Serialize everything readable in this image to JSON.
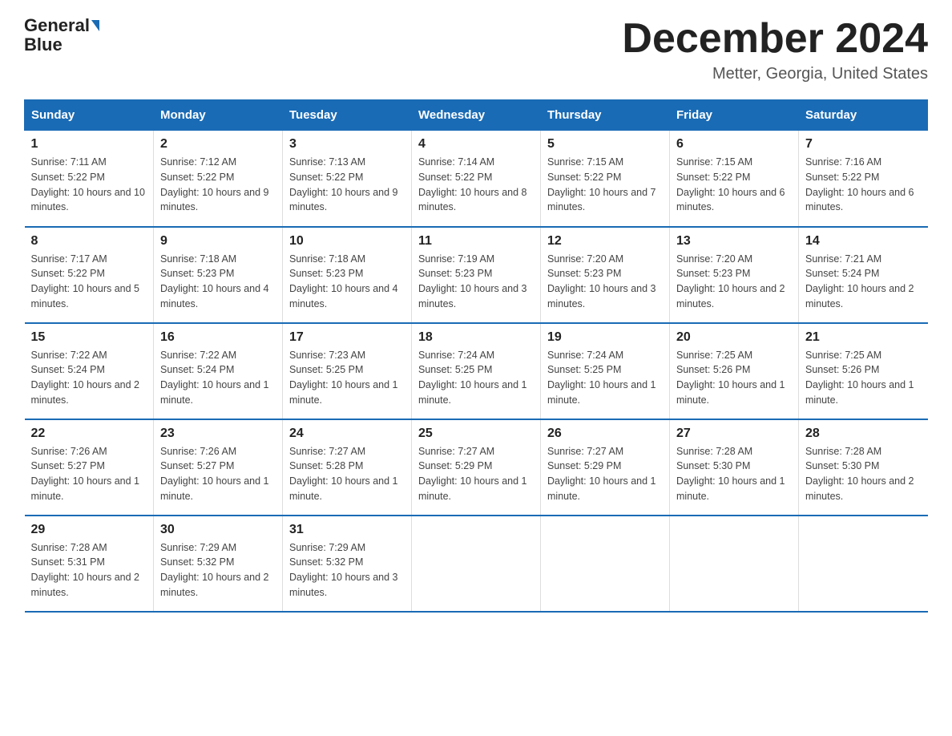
{
  "logo": {
    "text_general": "General",
    "text_blue": "Blue"
  },
  "title": "December 2024",
  "location": "Metter, Georgia, United States",
  "days_of_week": [
    "Sunday",
    "Monday",
    "Tuesday",
    "Wednesday",
    "Thursday",
    "Friday",
    "Saturday"
  ],
  "weeks": [
    [
      {
        "day": "1",
        "sunrise": "7:11 AM",
        "sunset": "5:22 PM",
        "daylight": "10 hours and 10 minutes."
      },
      {
        "day": "2",
        "sunrise": "7:12 AM",
        "sunset": "5:22 PM",
        "daylight": "10 hours and 9 minutes."
      },
      {
        "day": "3",
        "sunrise": "7:13 AM",
        "sunset": "5:22 PM",
        "daylight": "10 hours and 9 minutes."
      },
      {
        "day": "4",
        "sunrise": "7:14 AM",
        "sunset": "5:22 PM",
        "daylight": "10 hours and 8 minutes."
      },
      {
        "day": "5",
        "sunrise": "7:15 AM",
        "sunset": "5:22 PM",
        "daylight": "10 hours and 7 minutes."
      },
      {
        "day": "6",
        "sunrise": "7:15 AM",
        "sunset": "5:22 PM",
        "daylight": "10 hours and 6 minutes."
      },
      {
        "day": "7",
        "sunrise": "7:16 AM",
        "sunset": "5:22 PM",
        "daylight": "10 hours and 6 minutes."
      }
    ],
    [
      {
        "day": "8",
        "sunrise": "7:17 AM",
        "sunset": "5:22 PM",
        "daylight": "10 hours and 5 minutes."
      },
      {
        "day": "9",
        "sunrise": "7:18 AM",
        "sunset": "5:23 PM",
        "daylight": "10 hours and 4 minutes."
      },
      {
        "day": "10",
        "sunrise": "7:18 AM",
        "sunset": "5:23 PM",
        "daylight": "10 hours and 4 minutes."
      },
      {
        "day": "11",
        "sunrise": "7:19 AM",
        "sunset": "5:23 PM",
        "daylight": "10 hours and 3 minutes."
      },
      {
        "day": "12",
        "sunrise": "7:20 AM",
        "sunset": "5:23 PM",
        "daylight": "10 hours and 3 minutes."
      },
      {
        "day": "13",
        "sunrise": "7:20 AM",
        "sunset": "5:23 PM",
        "daylight": "10 hours and 2 minutes."
      },
      {
        "day": "14",
        "sunrise": "7:21 AM",
        "sunset": "5:24 PM",
        "daylight": "10 hours and 2 minutes."
      }
    ],
    [
      {
        "day": "15",
        "sunrise": "7:22 AM",
        "sunset": "5:24 PM",
        "daylight": "10 hours and 2 minutes."
      },
      {
        "day": "16",
        "sunrise": "7:22 AM",
        "sunset": "5:24 PM",
        "daylight": "10 hours and 1 minute."
      },
      {
        "day": "17",
        "sunrise": "7:23 AM",
        "sunset": "5:25 PM",
        "daylight": "10 hours and 1 minute."
      },
      {
        "day": "18",
        "sunrise": "7:24 AM",
        "sunset": "5:25 PM",
        "daylight": "10 hours and 1 minute."
      },
      {
        "day": "19",
        "sunrise": "7:24 AM",
        "sunset": "5:25 PM",
        "daylight": "10 hours and 1 minute."
      },
      {
        "day": "20",
        "sunrise": "7:25 AM",
        "sunset": "5:26 PM",
        "daylight": "10 hours and 1 minute."
      },
      {
        "day": "21",
        "sunrise": "7:25 AM",
        "sunset": "5:26 PM",
        "daylight": "10 hours and 1 minute."
      }
    ],
    [
      {
        "day": "22",
        "sunrise": "7:26 AM",
        "sunset": "5:27 PM",
        "daylight": "10 hours and 1 minute."
      },
      {
        "day": "23",
        "sunrise": "7:26 AM",
        "sunset": "5:27 PM",
        "daylight": "10 hours and 1 minute."
      },
      {
        "day": "24",
        "sunrise": "7:27 AM",
        "sunset": "5:28 PM",
        "daylight": "10 hours and 1 minute."
      },
      {
        "day": "25",
        "sunrise": "7:27 AM",
        "sunset": "5:29 PM",
        "daylight": "10 hours and 1 minute."
      },
      {
        "day": "26",
        "sunrise": "7:27 AM",
        "sunset": "5:29 PM",
        "daylight": "10 hours and 1 minute."
      },
      {
        "day": "27",
        "sunrise": "7:28 AM",
        "sunset": "5:30 PM",
        "daylight": "10 hours and 1 minute."
      },
      {
        "day": "28",
        "sunrise": "7:28 AM",
        "sunset": "5:30 PM",
        "daylight": "10 hours and 2 minutes."
      }
    ],
    [
      {
        "day": "29",
        "sunrise": "7:28 AM",
        "sunset": "5:31 PM",
        "daylight": "10 hours and 2 minutes."
      },
      {
        "day": "30",
        "sunrise": "7:29 AM",
        "sunset": "5:32 PM",
        "daylight": "10 hours and 2 minutes."
      },
      {
        "day": "31",
        "sunrise": "7:29 AM",
        "sunset": "5:32 PM",
        "daylight": "10 hours and 3 minutes."
      },
      null,
      null,
      null,
      null
    ]
  ],
  "labels": {
    "sunrise": "Sunrise:",
    "sunset": "Sunset:",
    "daylight": "Daylight:"
  }
}
